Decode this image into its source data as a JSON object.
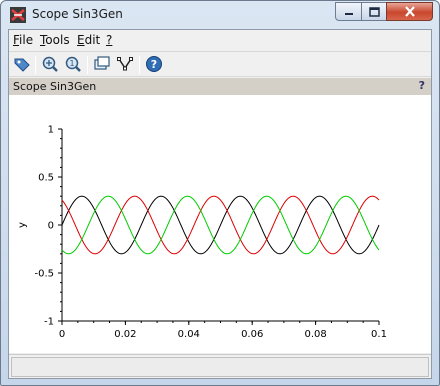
{
  "window": {
    "title": "Scope Sin3Gen",
    "icon": "scilab-icon"
  },
  "menubar": {
    "items": [
      {
        "label": "File",
        "underline": "F",
        "rest": "ile"
      },
      {
        "label": "Tools",
        "underline": "T",
        "rest": "ools"
      },
      {
        "label": "Edit",
        "underline": "E",
        "rest": "dit"
      },
      {
        "label": "?",
        "underline": "?",
        "rest": ""
      }
    ]
  },
  "toolbar": {
    "buttons": [
      "datatip-icon",
      "zoom-in-icon",
      "zoom-out-icon",
      "rotate-icon",
      "select-axes-icon",
      "help-icon"
    ]
  },
  "panel": {
    "title": "Scope Sin3Gen",
    "help": "?"
  },
  "chart_data": {
    "type": "line",
    "title": "",
    "xlabel": "",
    "ylabel": "y",
    "xlim": [
      0,
      0.1
    ],
    "ylim": [
      -1,
      1
    ],
    "x_ticks": [
      "0",
      "0.02",
      "0.04",
      "0.06",
      "0.08",
      "0.1"
    ],
    "y_ticks": [
      "1",
      "0.5",
      "0",
      "-0.5",
      "-1"
    ],
    "grid": false,
    "series": [
      {
        "color": "#000000",
        "amplitude": 0.3,
        "frequency_hz": 40,
        "phase_deg": 0
      },
      {
        "color": "#dd0000",
        "amplitude": 0.3,
        "frequency_hz": 40,
        "phase_deg": 120
      },
      {
        "color": "#00cc00",
        "amplitude": 0.3,
        "frequency_hz": 40,
        "phase_deg": 240
      }
    ]
  },
  "statusbar": {
    "text": ""
  }
}
